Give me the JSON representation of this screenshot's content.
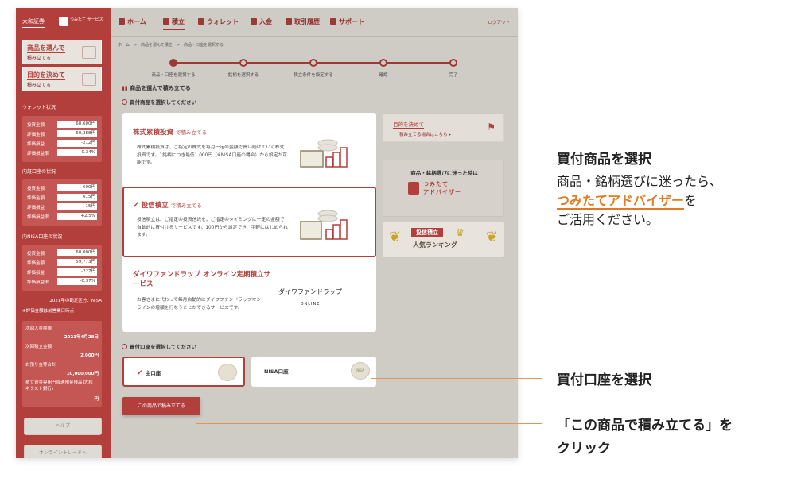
{
  "sidebar": {
    "logo_text": "大和証券",
    "brand_text": "つみたて サービス",
    "btn_product": {
      "l1": "商品を選んで",
      "l2": "積み立てる"
    },
    "btn_purpose": {
      "l1": "目的を決めて",
      "l2": "積み立てる"
    },
    "wallet_head": "ウォレット状況",
    "wallet_rows": [
      {
        "k": "投資金額",
        "v": "60,600円"
      },
      {
        "k": "評価金額",
        "v": "60,388円"
      },
      {
        "k": "評価損益",
        "v": "-212円"
      },
      {
        "k": "評価損益率",
        "v": "-0.34%"
      }
    ],
    "domestic_head": "内証口座の状況",
    "domestic_rows": [
      {
        "k": "投資金額",
        "v": "600円"
      },
      {
        "k": "評価金額",
        "v": "615円"
      },
      {
        "k": "評価損益",
        "v": "+15円"
      },
      {
        "k": "評価損益率",
        "v": "+2.5%"
      }
    ],
    "nisa_head": "内NISA口座の状況",
    "nisa_rows": [
      {
        "k": "投資金額",
        "v": "60,000円"
      },
      {
        "k": "評価金額",
        "v": "59,773円"
      },
      {
        "k": "評価損益",
        "v": "-227円"
      },
      {
        "k": "評価損益率",
        "v": "-0.37%"
      }
    ],
    "note1": "2021年の勘定区分：NISA",
    "note2": "※評価金額は前営業日時点",
    "next_deposit_label": "次回入金期限",
    "next_deposit_date": "2021年4月28日",
    "next_amount_label": "次回積立金額",
    "next_amount": "2,000円",
    "deposit_total_label": "お預り金等合計",
    "deposit_total": "10,000,000円",
    "account_balance_label": "積立資金専用円普通預金残高(大和ネクスト銀行)",
    "account_balance": "-円",
    "help": "ヘルプ",
    "online_trade": "オンライントレードへ"
  },
  "nav": {
    "home": "ホーム",
    "tsumitate": "積立",
    "wallet": "ウォレット",
    "deposit": "入金",
    "history": "取引履歴",
    "support": "サポート",
    "logout": "ログアウト"
  },
  "breadcrumb": "ホーム　>　商品を選んで積立　>　商品・口座を選択する",
  "steps": [
    "商品・口座を選択する",
    "銘柄を選択する",
    "積立条件を設定する",
    "確認",
    "完了"
  ],
  "page_title": "商品を選んで積み立てる",
  "section_product": "買付商品を選択してください",
  "products": [
    {
      "title": "株式累積投資",
      "suffix": "で積み立てる",
      "desc": "株式累積投資は、ご指定の株式を毎月一定の金額で買い続けていく株式投資です。1銘柄につき最低1,000円（※NISA口座の場合）から設定が可能です。"
    },
    {
      "title": "投信積立",
      "suffix": "で積み立てる",
      "desc": "投信積立は、ご指定の投資信託を、ご指定のタイミングに一定の金額で自動的に買付けるサービスです。100円から設定でき、手軽にはじめられます。"
    },
    {
      "title": "ダイワファンドラップ オンライン定期積立サービス",
      "suffix": "",
      "desc": "お客さまに代わって毎月自動的にダイワファンドラップオンラインの增額を行なうことができるサービスです。"
    }
  ],
  "fundwrap_logo": {
    "a": "ダイワファンドラップ",
    "b": "ONLINE"
  },
  "banners": {
    "purpose": {
      "t": "目的を決めて",
      "s": "積み立てる場合はこちら ▸"
    },
    "advisor": {
      "t": "商品・銘柄選びに迷った時は",
      "b1": "つみたて",
      "b2": "アドバイザー"
    },
    "ranking": {
      "tag": "投信積立",
      "t": "人気ランキング"
    }
  },
  "section_account": "買付口座を選択してください",
  "accounts": [
    "主口座",
    "NISA口座"
  ],
  "nisa_coin": "NISA",
  "go_button": "この商品で積み立てる",
  "callouts": {
    "c1_head": "買付商品を選択",
    "c1_b1": "商品・銘柄選びに迷ったら、",
    "c1_hl": "つみたてアドバイザー",
    "c1_b2": "を",
    "c1_b3": "ご活用ください。",
    "c2_head": "買付口座を選択",
    "c3_l1": "「この商品で積み立てる」を",
    "c3_l2": "クリック"
  },
  "colors": {
    "brand": "#b23f3b",
    "accent": "#e07b23"
  }
}
